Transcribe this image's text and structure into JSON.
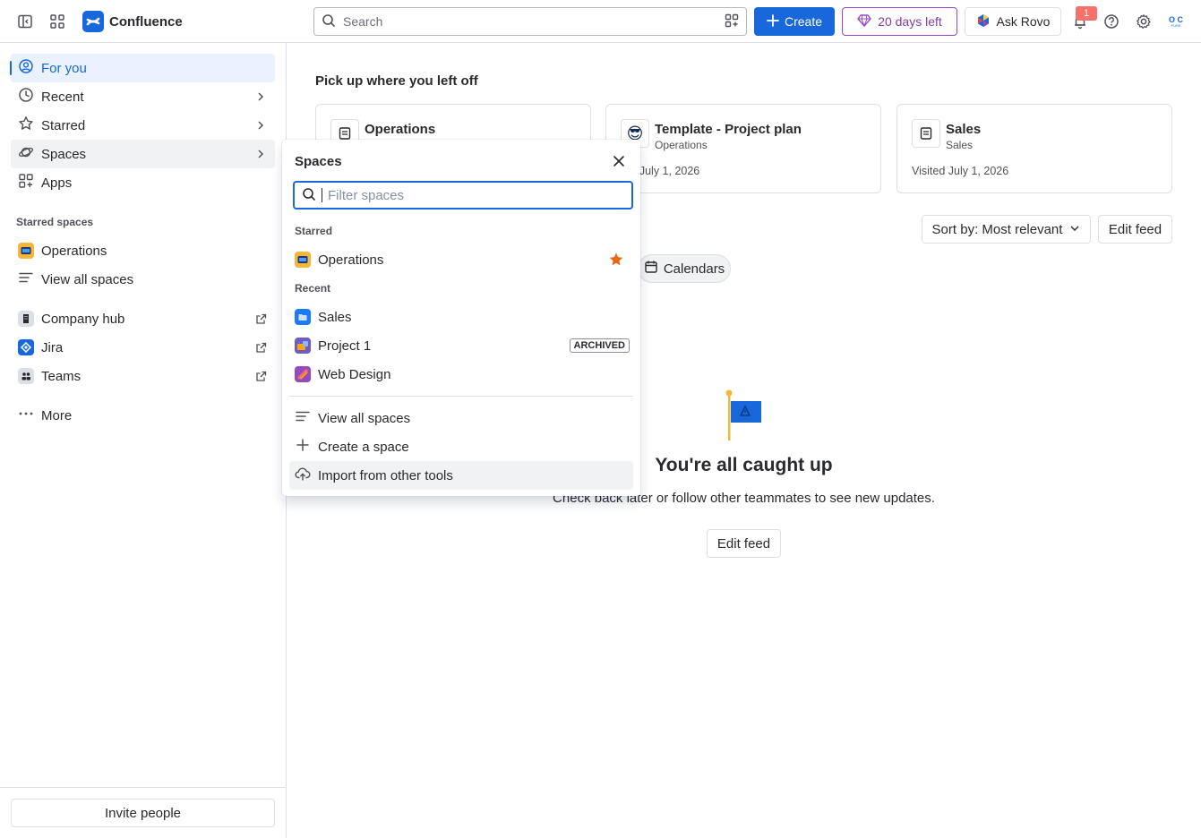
{
  "topbar": {
    "app_name": "Confluence",
    "search_placeholder": "Search",
    "create_label": "Create",
    "trial_label": "20 days left",
    "rovo_label": "Ask Rovo",
    "notification_count": "1",
    "avatar_initials_top": "O C",
    "avatar_initials_bottom": "PURE"
  },
  "sidebar": {
    "items": [
      {
        "label": "For you"
      },
      {
        "label": "Recent"
      },
      {
        "label": "Starred"
      },
      {
        "label": "Spaces"
      },
      {
        "label": "Apps"
      }
    ],
    "starred_header": "Starred spaces",
    "starred_spaces": [
      {
        "label": "Operations"
      },
      {
        "label": "View all spaces"
      }
    ],
    "apps": [
      {
        "label": "Company hub"
      },
      {
        "label": "Jira"
      },
      {
        "label": "Teams"
      }
    ],
    "more_label": "More",
    "invite_label": "Invite people"
  },
  "main": {
    "pick_up_title": "Pick up where you left off",
    "cards": [
      {
        "title": "Operations",
        "subtitle": "",
        "visited": ""
      },
      {
        "title": "Template - Project plan",
        "subtitle": "Operations",
        "visited": "ted July 1, 2026"
      },
      {
        "title": "Sales",
        "subtitle": "Sales",
        "visited": "Visited July 1, 2026"
      }
    ],
    "sort_label": "Sort by: Most relevant",
    "edit_feed_label": "Edit feed",
    "chip_label": "Calendars",
    "caught_up_title": "You're all caught up",
    "caught_up_sub": "Check back later or follow other teammates to see new updates.",
    "edit_feed_bottom_label": "Edit feed"
  },
  "popup": {
    "title": "Spaces",
    "filter_placeholder": "Filter spaces",
    "starred_header": "Starred",
    "starred": [
      {
        "label": "Operations"
      }
    ],
    "recent_header": "Recent",
    "recent": [
      {
        "label": "Sales"
      },
      {
        "label": "Project 1",
        "badge": "ARCHIVED"
      },
      {
        "label": "Web Design"
      }
    ],
    "actions": [
      {
        "label": "View all spaces"
      },
      {
        "label": "Create a space"
      },
      {
        "label": "Import from other tools"
      }
    ]
  },
  "colors": {
    "brand_blue": "#1868db",
    "trial_purple": "#803fa5",
    "star_orange": "#e56910",
    "notification_red": "#f87168"
  }
}
